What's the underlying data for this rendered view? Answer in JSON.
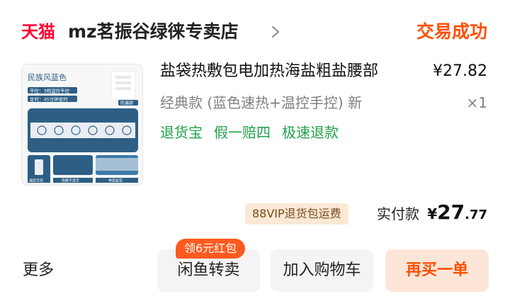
{
  "header": {
    "tmall_logo": "天猫",
    "shop_name": "mz茗振谷绿徕专卖店",
    "order_status": "交易成功"
  },
  "product": {
    "thumbnail": {
      "label": "民族风蓝色",
      "feature_1": "手控：3档温控手控",
      "feature_2": "定时：45分钟定时",
      "tag": "防漏袋",
      "caption_1": "温控手控",
      "caption_2": "热敷不烫手",
      "caption_3": "单层盐包"
    },
    "title": "盐袋热敷包电加热海盐粗盐腰部",
    "price": "¥27.82",
    "sku": "经典款 (蓝色速热+温控手控) 新",
    "quantity": "×1",
    "services": [
      "退货宝",
      "假一赔四",
      "极速退款"
    ]
  },
  "payment": {
    "vip_badge": "88VIP退货包运费",
    "paid_label": "实付款",
    "currency": "¥",
    "amount_int": "27",
    "amount_dec": ".77"
  },
  "actions": {
    "more": "更多",
    "xianyu": "闲鱼转卖",
    "coupon": "领6元红包",
    "add_cart": "加入购物车",
    "rebuy": "再买一单"
  },
  "colors": {
    "tmall_red": "#ff0036",
    "accent_orange": "#ff5000",
    "service_green": "#20a04a",
    "thumb_blue": "#2d5f86"
  }
}
